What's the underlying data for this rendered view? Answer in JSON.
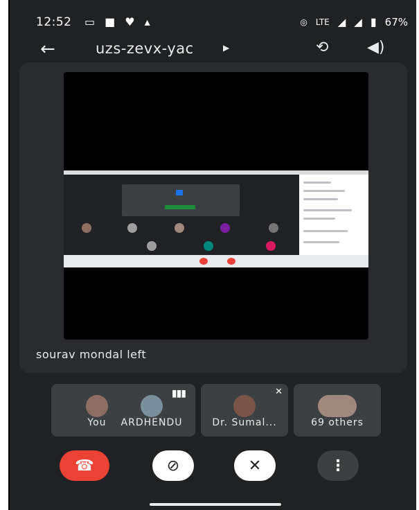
{
  "status_bar": {
    "time": "12:52",
    "battery": "67%",
    "signal_text": "LTE",
    "left_icons": [
      "cast-icon",
      "notification-icon",
      "heart-icon",
      "thumb-icon"
    ]
  },
  "top_bar": {
    "meeting_code": "uzs-zevx-yac",
    "back_icon": "arrow-left-icon",
    "switch_camera_icon": "camera-switch-icon",
    "audio_output_icon": "speaker-icon"
  },
  "notification": "sourav mondal left",
  "participants": [
    {
      "name": "You",
      "muted": true,
      "speaking": false,
      "avatar_color": "#8d6e63"
    },
    {
      "name": "ARDHENDU",
      "muted": false,
      "speaking": true,
      "avatar_color": "#78909c"
    },
    {
      "name": "Dr. Sumal...",
      "muted": true,
      "speaking": false,
      "avatar_color": "#795548"
    },
    {
      "name": "69 others",
      "muted": false,
      "speaking": false,
      "avatar_color": "#a1887f"
    }
  ],
  "controls": {
    "end_call_icon": "phone-hangup-icon",
    "camera_icon": "camera-off-icon",
    "mic_icon": "mic-off-icon",
    "more_icon": "more-vertical-icon"
  },
  "colors": {
    "background": "#202124",
    "tile": "#3c4043",
    "end_call": "#ea4335"
  }
}
